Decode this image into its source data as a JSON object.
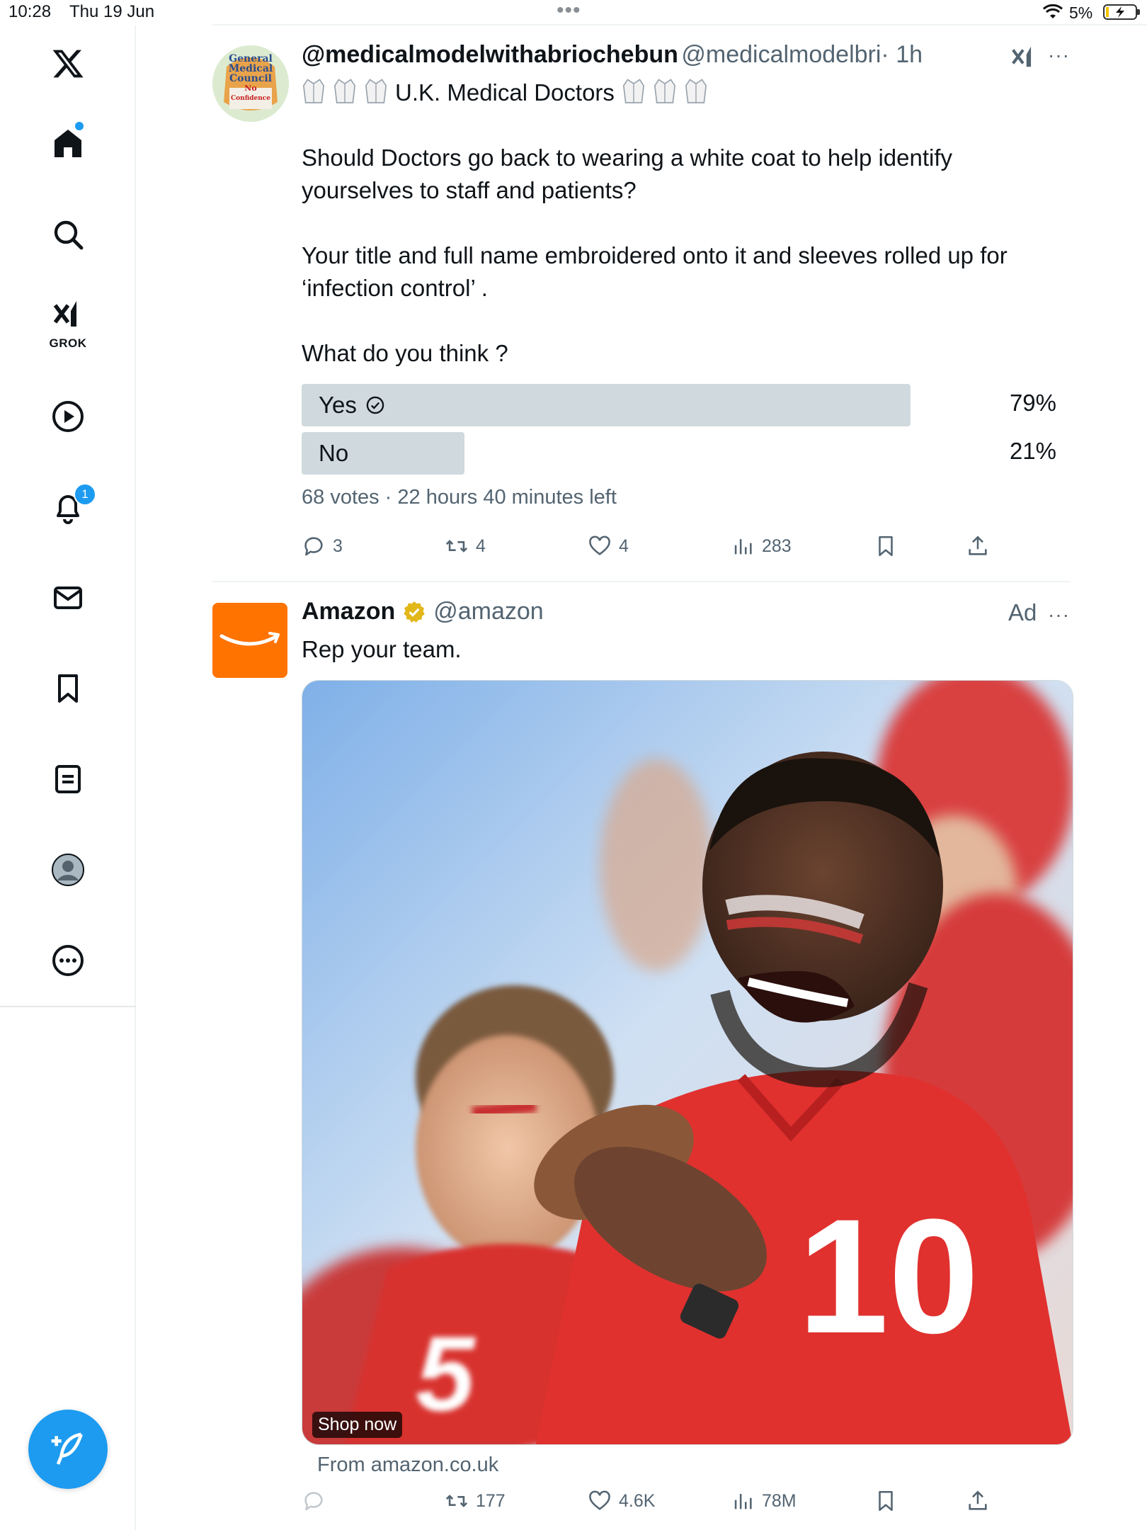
{
  "status": {
    "time": "10:28",
    "date": "Thu 19 Jun",
    "battery": "5%"
  },
  "sidebar": {
    "items": [
      {
        "name": "home",
        "icon": "home-icon"
      },
      {
        "name": "explore",
        "icon": "search-icon"
      },
      {
        "name": "grok",
        "icon": "grok-icon",
        "label": "GROK"
      },
      {
        "name": "video",
        "icon": "play-icon"
      },
      {
        "name": "notifications",
        "icon": "bell-icon",
        "badge": "1"
      },
      {
        "name": "messages",
        "icon": "mail-icon"
      },
      {
        "name": "bookmarks",
        "icon": "bookmark-icon"
      },
      {
        "name": "lists",
        "icon": "list-icon"
      },
      {
        "name": "profile",
        "icon": "avatar-icon"
      },
      {
        "name": "more",
        "icon": "more-circle-icon"
      }
    ]
  },
  "tweet1": {
    "display_name": "@medicalmodelwithabriochebun",
    "handle": "@medicalmodelbri",
    "time": "· 1h",
    "bio_line": "U.K. Medical Doctors",
    "avatar_text": [
      "General",
      "Medical",
      "Council",
      "No",
      "Confidence"
    ],
    "paragraphs": [
      "Should Doctors go back to wearing a white coat to help identify yourselves to staff and patients?",
      "Your title and full name embroidered onto it and sleeves rolled up for ‘infection control’ .",
      "What do you think ?"
    ],
    "poll": {
      "options": [
        {
          "label": "Yes",
          "percent_text": "79%",
          "share": 0.79,
          "winner": true
        },
        {
          "label": "No",
          "percent_text": "21%",
          "share": 0.21,
          "winner": false
        }
      ],
      "summary": "68 votes · 22 hours 40 minutes left"
    },
    "actions": {
      "replies": "3",
      "reposts": "4",
      "likes": "4",
      "views": "283"
    }
  },
  "ad": {
    "display_name": "Amazon",
    "handle": "@amazon",
    "ad_label": "Ad",
    "text": "Rep your team.",
    "cta": "Shop now",
    "source": "From amazon.co.uk",
    "shirt_number_1": "10",
    "shirt_number_2": "5",
    "actions": {
      "replies": "",
      "reposts": "177",
      "likes": "4.6K",
      "views": "78M"
    }
  },
  "colors": {
    "accent": "#1d9bf0",
    "amazon_orange": "#ff7300",
    "verified_gold": "#e2b719",
    "poll_bar": "#cfd9de"
  }
}
